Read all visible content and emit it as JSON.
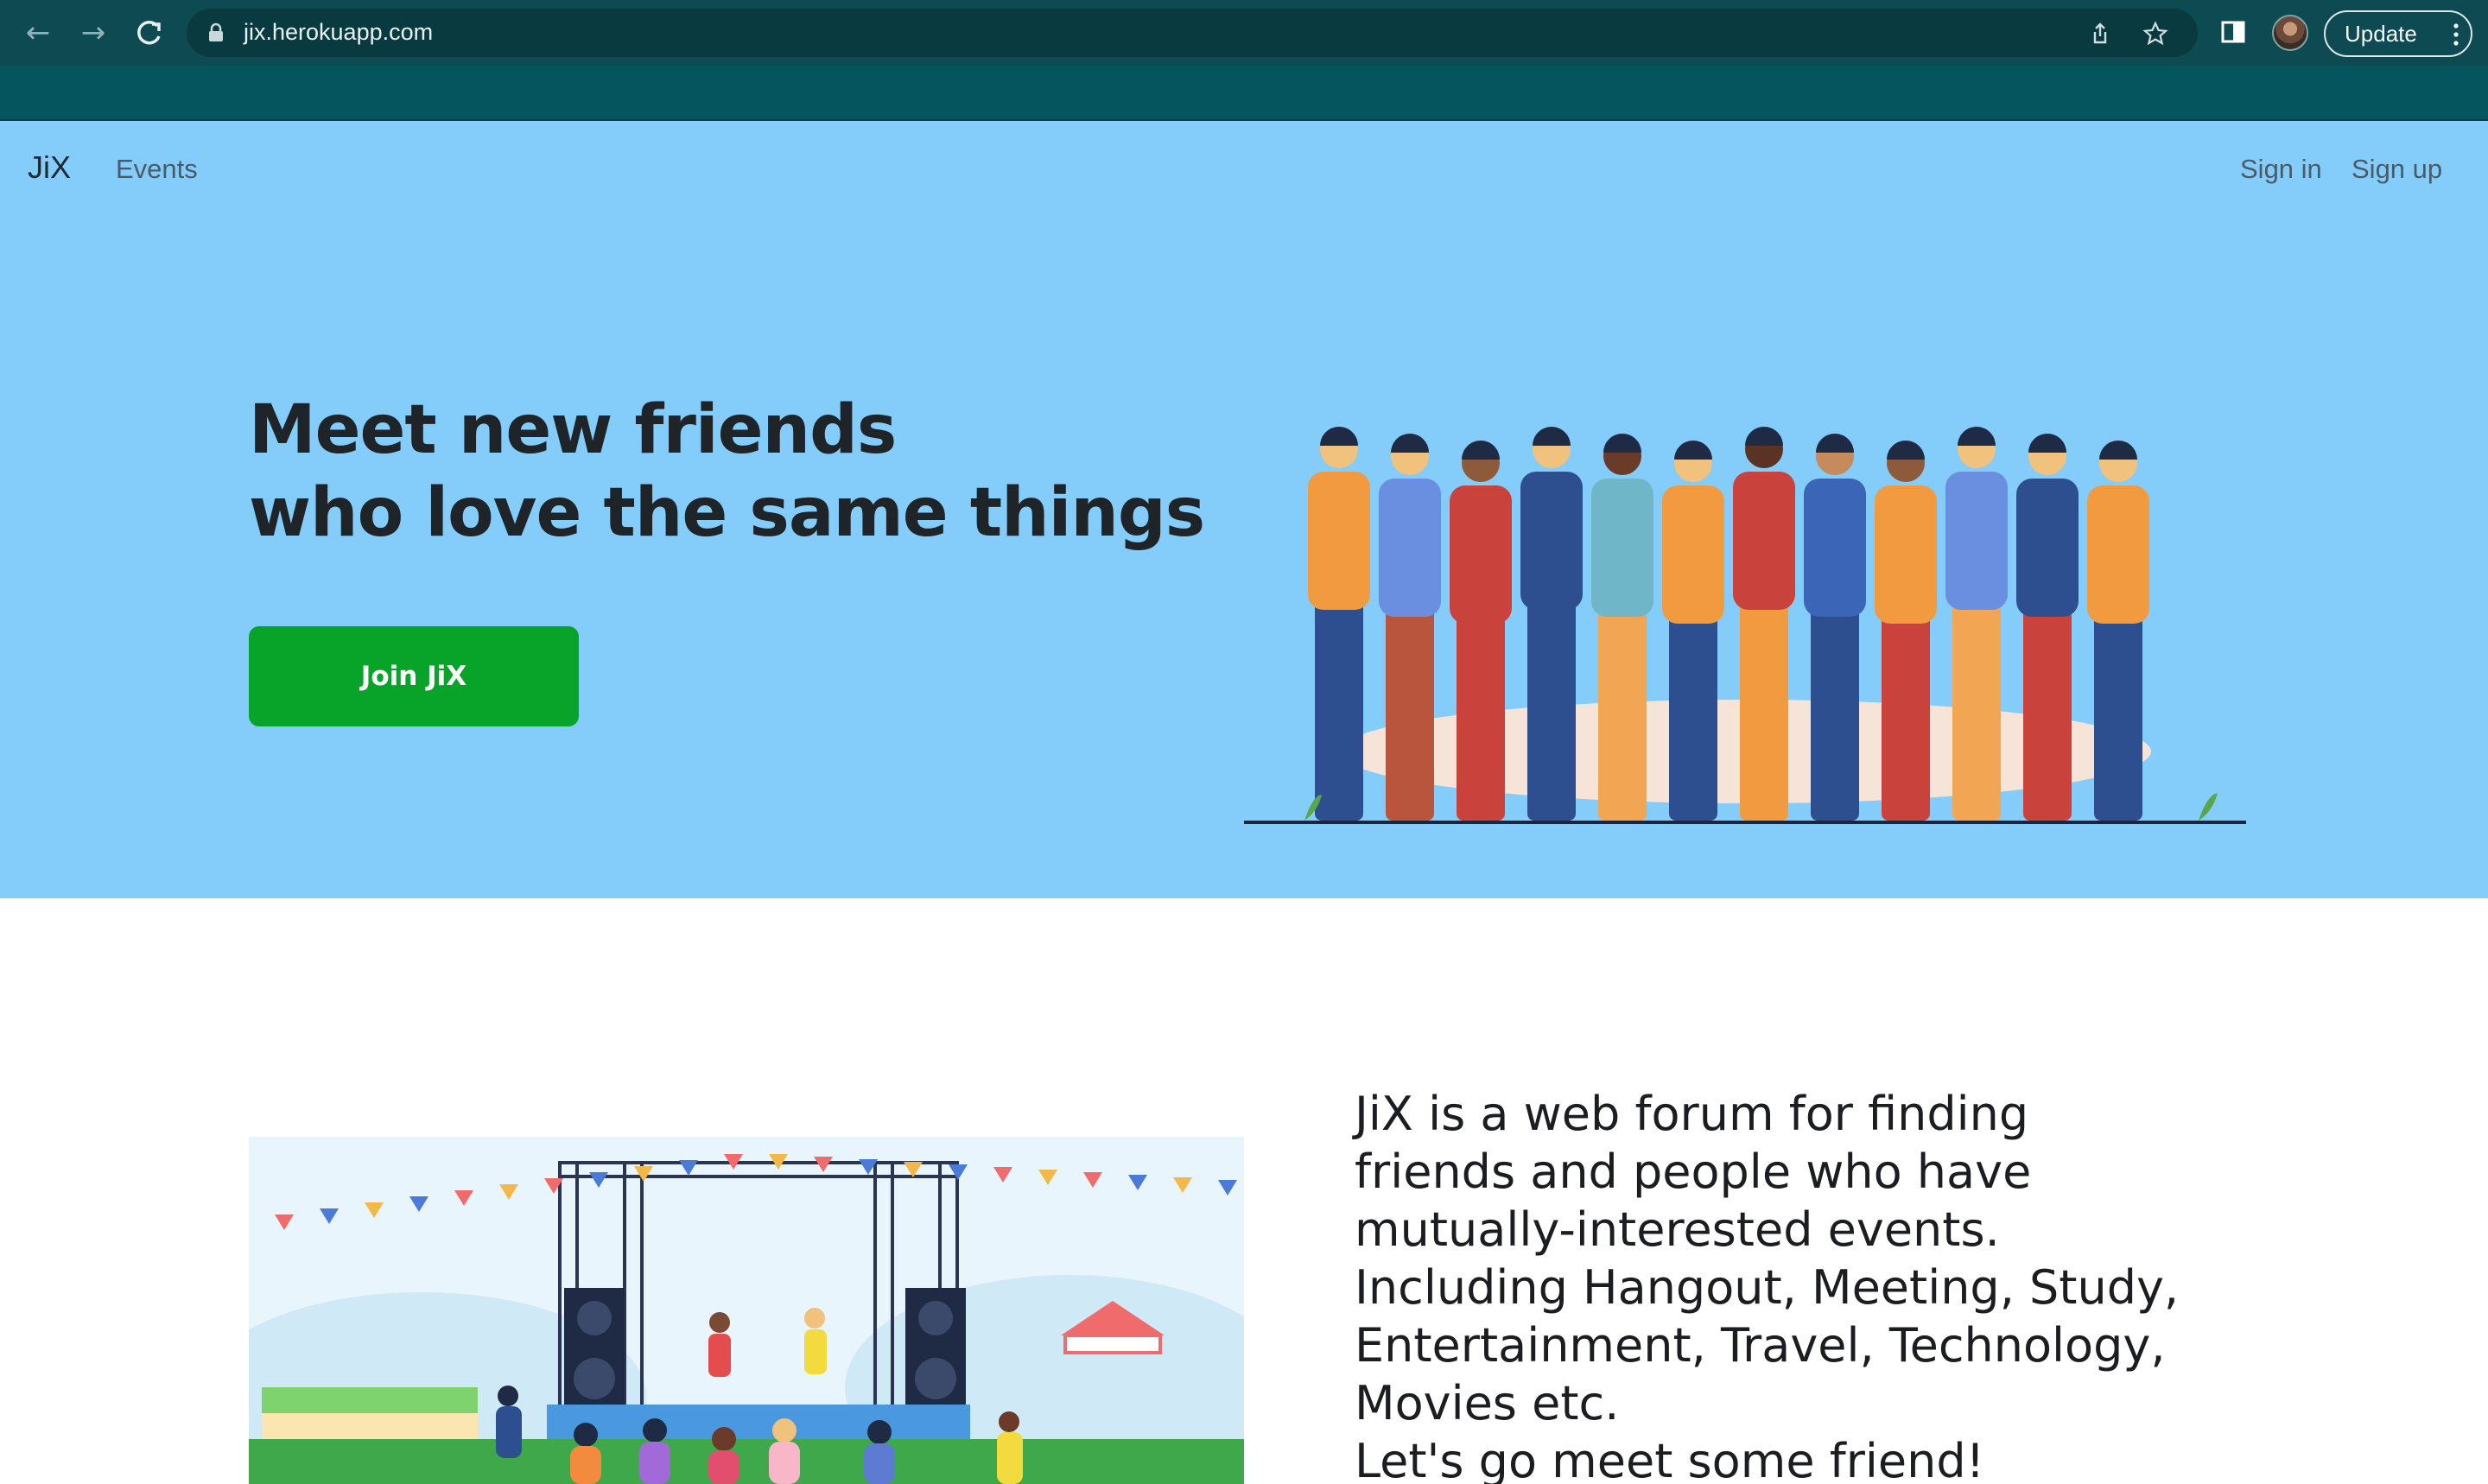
{
  "browser": {
    "url": "jix.herokuapp.com",
    "update_label": "Update",
    "icons": [
      "back-arrow-icon",
      "forward-arrow-icon",
      "reload-icon",
      "lock-icon",
      "share-icon",
      "bookmark-star-icon",
      "side-panel-icon",
      "profile-avatar",
      "kebab-menu-icon"
    ]
  },
  "site": {
    "brand": "JiX",
    "nav": {
      "events": "Events",
      "sign_in": "Sign in",
      "sign_up": "Sign up"
    },
    "colors": {
      "hero_bg": "#84cdfa",
      "cta": "#07a429",
      "chrome": "#0d4a52"
    }
  },
  "hero": {
    "title_line1": "Meet new friends",
    "title_line2": "who love the same things",
    "cta_label": "Join JiX"
  },
  "about": {
    "lines": [
      "JiX is a web forum for finding",
      "friends and people who have",
      "mutually-interested events.",
      "Including Hangout, Meeting, Study,",
      "Entertainment, Travel, Technology,",
      "Movies etc.",
      "Let's go meet some friend!"
    ]
  }
}
